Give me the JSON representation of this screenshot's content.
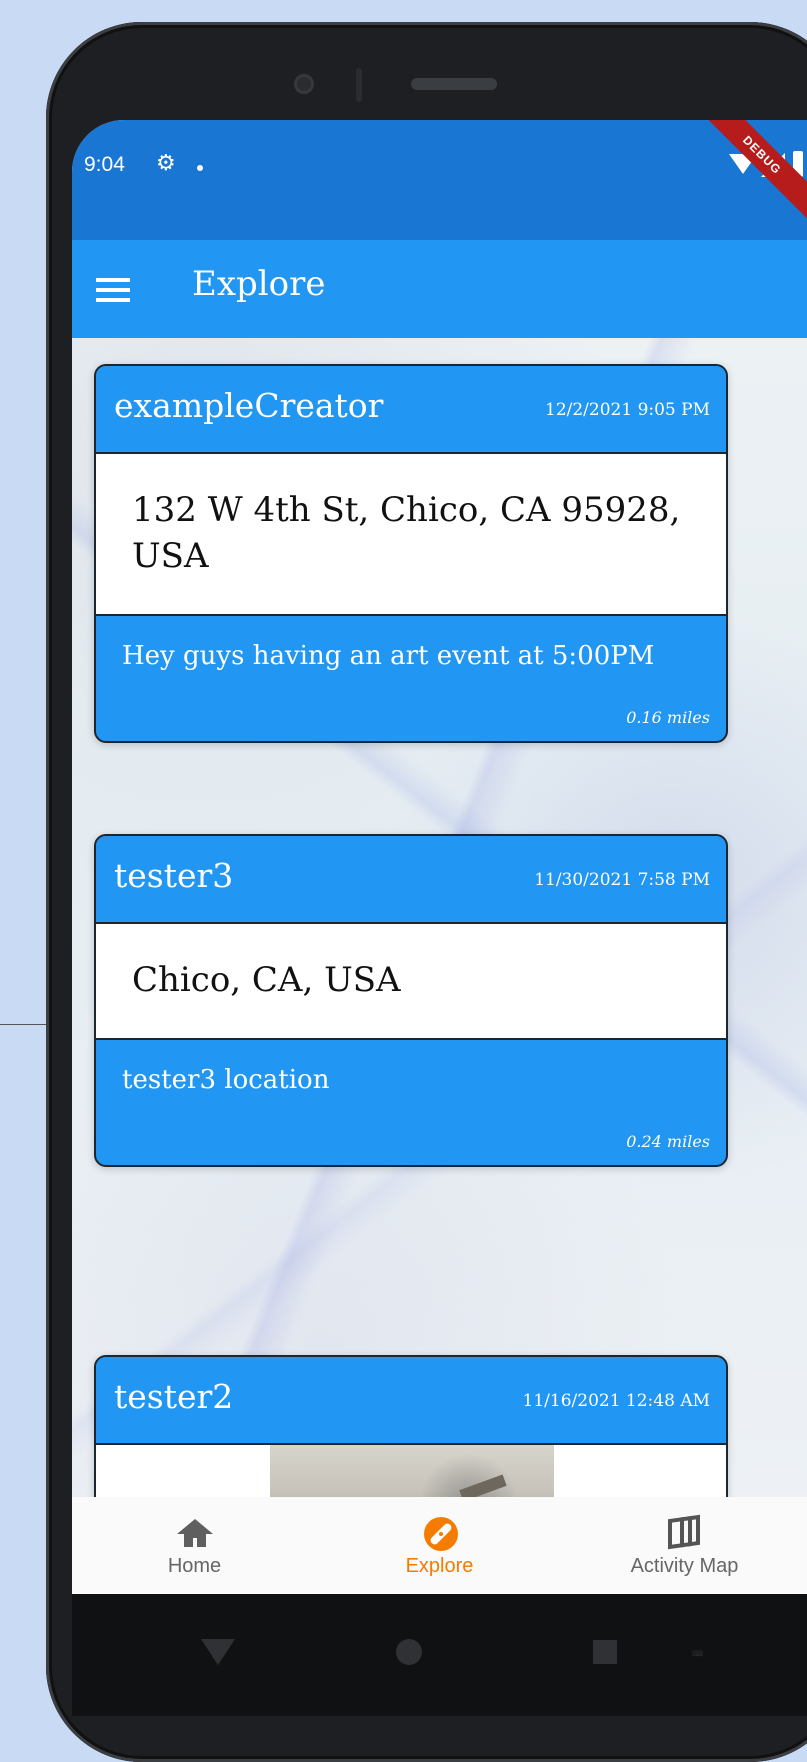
{
  "status_bar": {
    "time": "9:04",
    "settings_icon": "gear-icon",
    "debug_label": "DEBUG"
  },
  "app_bar": {
    "menu_icon": "menu-icon",
    "title": "Explore"
  },
  "posts": [
    {
      "creator": "exampleCreator",
      "date": "12/2/2021 9:05 PM",
      "address": "132 W 4th St, Chico, CA 95928, USA",
      "message": "Hey guys having an art event at 5:00PM",
      "distance": "0.16 miles"
    },
    {
      "creator": "tester3",
      "date": "11/30/2021 7:58 PM",
      "address": "Chico, CA, USA",
      "message": "tester3 location",
      "distance": "0.24 miles"
    },
    {
      "creator": "tester2",
      "date": "11/16/2021 12:48 AM"
    }
  ],
  "bottom_nav": {
    "items": [
      {
        "label": "Home",
        "icon": "home-icon",
        "active": false
      },
      {
        "label": "Explore",
        "icon": "compass-icon",
        "active": true
      },
      {
        "label": "Activity Map",
        "icon": "map-icon",
        "active": false
      }
    ],
    "active_color": "#f57c00",
    "inactive_color": "#666666"
  },
  "theme": {
    "primary": "#2196f3",
    "primary_dark": "#1976d2",
    "background": "#c9daf4"
  }
}
